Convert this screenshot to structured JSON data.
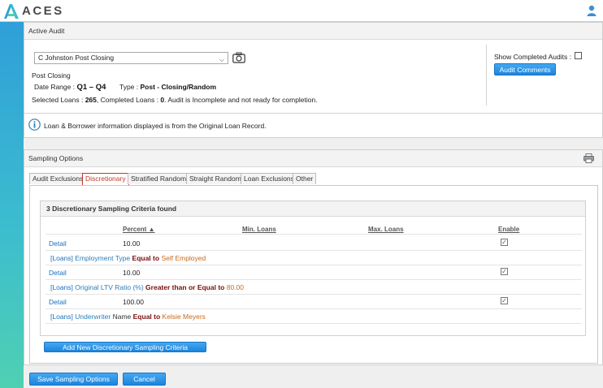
{
  "app": {
    "logo": "ACES"
  },
  "active_audit": {
    "header": "Active Audit",
    "selected_audit": "C Johnston Post Closing",
    "audit_type_label": "Post Closing",
    "date_range_label": "Date Range :",
    "date_range_value": "Q1 – Q4",
    "type_label": "Type :",
    "type_value": "Post - Closing/Random",
    "summary_prefix": "Selected Loans :",
    "selected_loans": "265",
    "completed_label": ", Completed Loans :",
    "completed_loans": "0",
    "status_text": ". Audit is Incomplete and not ready for completion.",
    "show_completed_label": "Show Completed Audits :",
    "audit_comments_button": "Audit Comments"
  },
  "info_banner": {
    "text": "Loan & Borrower information displayed is from the Original Loan Record."
  },
  "sampling": {
    "header": "Sampling Options",
    "tabs": [
      {
        "label": "Audit Exclusions"
      },
      {
        "label": "Discretionary"
      },
      {
        "label": "Stratified Random"
      },
      {
        "label": "Straight Random"
      },
      {
        "label": "Loan Exclusions"
      },
      {
        "label": "Other"
      }
    ],
    "found_text": "3 Discretionary Sampling Criteria found",
    "columns": {
      "percent": "Percent ▲",
      "min_loans": "Min. Loans",
      "max_loans": "Max. Loans",
      "enable": "Enable"
    },
    "rows": [
      {
        "detail": "Detail",
        "percent": "10.00",
        "tag": "[Loans]",
        "field_blue": "Employment Type",
        "field_plain": "",
        "op": "Equal to",
        "value": "Self Employed"
      },
      {
        "detail": "Detail",
        "percent": "10.00",
        "tag": "[Loans]",
        "field_blue": "Original LTV Ratio (%)",
        "field_plain": "",
        "op": "Greater than or Equal to",
        "value": "80.00"
      },
      {
        "detail": "Detail",
        "percent": "100.00",
        "tag": "[Loans]",
        "field_blue": "Underwriter",
        "field_plain": "Name",
        "op": "Equal to",
        "value": "Kelsie Meyers"
      }
    ],
    "add_button": "Add New Discretionary Sampling Criteria",
    "save_button": "Save Sampling Options",
    "cancel_button": "Cancel"
  },
  "colors": {
    "accent_blue": "#1d84dc",
    "active_tab": "#c0392b",
    "operator": "#7a0c0c",
    "value": "#c96a1a",
    "field": "#2b7fb8"
  }
}
